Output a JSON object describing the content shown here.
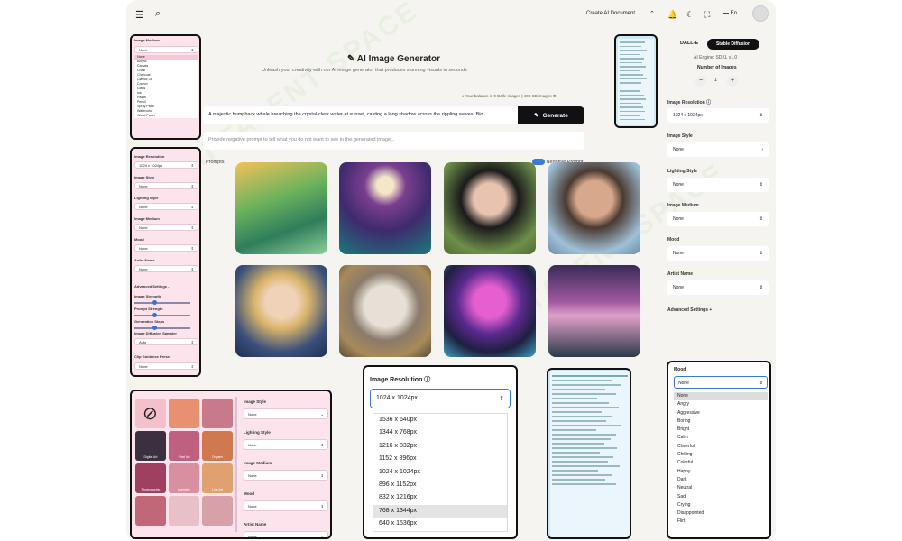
{
  "topbar": {
    "create_label": "Create AI Document",
    "lang": "En"
  },
  "main": {
    "title": "AI Image Generator",
    "subtitle": "Unleash your creativity with our AI image generator that produces stunning visuals in seconds",
    "balance": "Your balance is 0 Dalle images | 400 SD images",
    "prompt_value": "A majestic humpback whale breaching the crystal-clear water at sunset, casting a long shadow across the rippling waves. Bio",
    "generate_label": "Generate",
    "negative_placeholder": "Provide negative prompt to tell what you do not want to see in the generated image...",
    "tabs": [
      "Prompts",
      "Negative Prompt"
    ]
  },
  "right_panel": {
    "engine_tabs": [
      "DALL-E",
      "Stable Diffusion"
    ],
    "engine_text": "AI Engine: SDXL v1.0",
    "num_images_label": "Number of Images",
    "num_images_value": "1",
    "fields": [
      {
        "label": "Image Resolution",
        "value": "1024 x 1024px"
      },
      {
        "label": "Image Style",
        "value": "None"
      },
      {
        "label": "Lighting Style",
        "value": "None"
      },
      {
        "label": "Image Medium",
        "value": "None"
      },
      {
        "label": "Mood",
        "value": "None"
      },
      {
        "label": "Artist Name",
        "value": "None"
      }
    ],
    "advanced": "Advanced Settings +"
  },
  "medium_popup": {
    "label": "Image Medium",
    "value": "None",
    "options": [
      "None",
      "Acrylic",
      "Canvas",
      "Chalk",
      "Charcoal",
      "Classic Oil",
      "Crayon",
      "Glass",
      "Ink",
      "Pastel",
      "Pencil",
      "Spray Paint",
      "Watercolor",
      "Wood Panel"
    ]
  },
  "left_settings": {
    "fields": [
      {
        "label": "Image Resolution",
        "value": "1024 x 1024px"
      },
      {
        "label": "Image Style",
        "value": "None"
      },
      {
        "label": "Lighting Style",
        "value": "None"
      },
      {
        "label": "Image Medium",
        "value": "None"
      },
      {
        "label": "Mood",
        "value": "None"
      },
      {
        "label": "Artist Name",
        "value": "None"
      }
    ],
    "advanced": "Advanced Settings -",
    "sliders": [
      "Image Strength",
      "Prompt Strength",
      "Generation Steps"
    ],
    "sampler_label": "Image Diffusion Sampler",
    "sampler_value": "Auto",
    "clip_label": "Clip Guidance Preset",
    "clip_value": "None"
  },
  "style_panel": {
    "fields": [
      {
        "label": "Image Style",
        "value": "None"
      },
      {
        "label": "Lighting Style",
        "value": "None"
      },
      {
        "label": "Image Medium",
        "value": "None"
      },
      {
        "label": "Mood",
        "value": "None"
      },
      {
        "label": "Artist Name",
        "value": "None"
      }
    ],
    "styles": [
      "None",
      "",
      "",
      "Digital Art",
      "Pixel Art",
      "Origami",
      "Photographic",
      "Isometric",
      "Line Art",
      "",
      "",
      ""
    ]
  },
  "resolution_popup": {
    "label": "Image Resolution",
    "value": "1024 x 1024px",
    "options": [
      "1536 x 640px",
      "1344 x 768px",
      "1216 x 832px",
      "1152 x 896px",
      "1024 x 1024px",
      "896 x 1152px",
      "832 x 1216px",
      "768 x 1344px",
      "640 x 1536px"
    ],
    "highlighted": "768 x 1344px"
  },
  "mood_popup": {
    "label": "Mood",
    "value": "None",
    "options": [
      "None",
      "Angry",
      "Aggressive",
      "Boring",
      "Bright",
      "Calm",
      "Cheerful",
      "Chilling",
      "Colorful",
      "Happy",
      "Dark",
      "Neutral",
      "Sad",
      "Crying",
      "Disappointed",
      "Flirt"
    ]
  },
  "colors": {
    "accent": "#111111",
    "pink": "#fde4ec",
    "blue": "#cfe8f7"
  }
}
